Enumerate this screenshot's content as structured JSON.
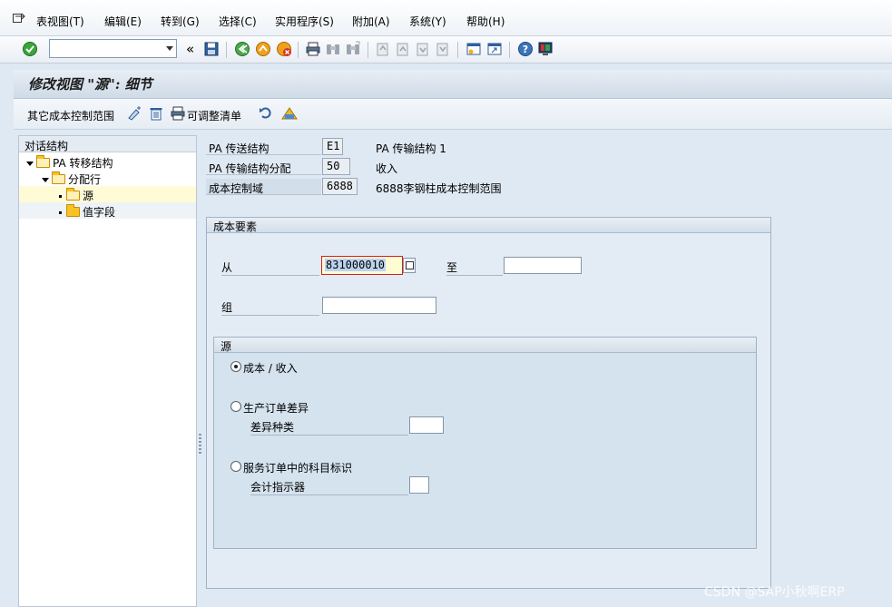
{
  "menu": [
    "表视图(T)",
    "编辑(E)",
    "转到(G)",
    "选择(C)",
    "实用程序(S)",
    "附加(A)",
    "系统(Y)",
    "帮助(H)"
  ],
  "toolbar": {
    "command_value": "",
    "collapse_glyph": "«"
  },
  "title": "修改视图 \"源\": 细节",
  "app_toolbar": {
    "other_range": "其它成本控制范围",
    "adjust_list": "可调整清单"
  },
  "tree": {
    "header": "对话结构",
    "nodes": [
      "PA 转移结构",
      "分配行",
      "源",
      "值字段"
    ]
  },
  "header_fields": [
    {
      "label": "PA 传送结构",
      "value": "E1",
      "desc": "PA 传输结构 1"
    },
    {
      "label": "PA 传输结构分配",
      "value": "50",
      "desc": "收入"
    },
    {
      "label": "成本控制域",
      "value": "6888",
      "desc": "6888李钢柱成本控制范围"
    }
  ],
  "cost_element_group": {
    "title": "成本要素",
    "from_label": "从",
    "from_value": "831000010",
    "to_label": "至",
    "to_value": "",
    "group_label": "组",
    "group_value": ""
  },
  "source_group": {
    "title": "源",
    "option_cost_revenue": "成本 / 收入",
    "option_prod_order_variance": "生产订单差异",
    "variance_category_label": "差异种类",
    "variance_category_value": "",
    "option_service_order": "服务订单中的科目标识",
    "accounting_indicator_label": "会计指示器",
    "accounting_indicator_value": "",
    "selected": "option_cost_revenue"
  },
  "watermark": "CSDN @SAP小秋啊ERP"
}
